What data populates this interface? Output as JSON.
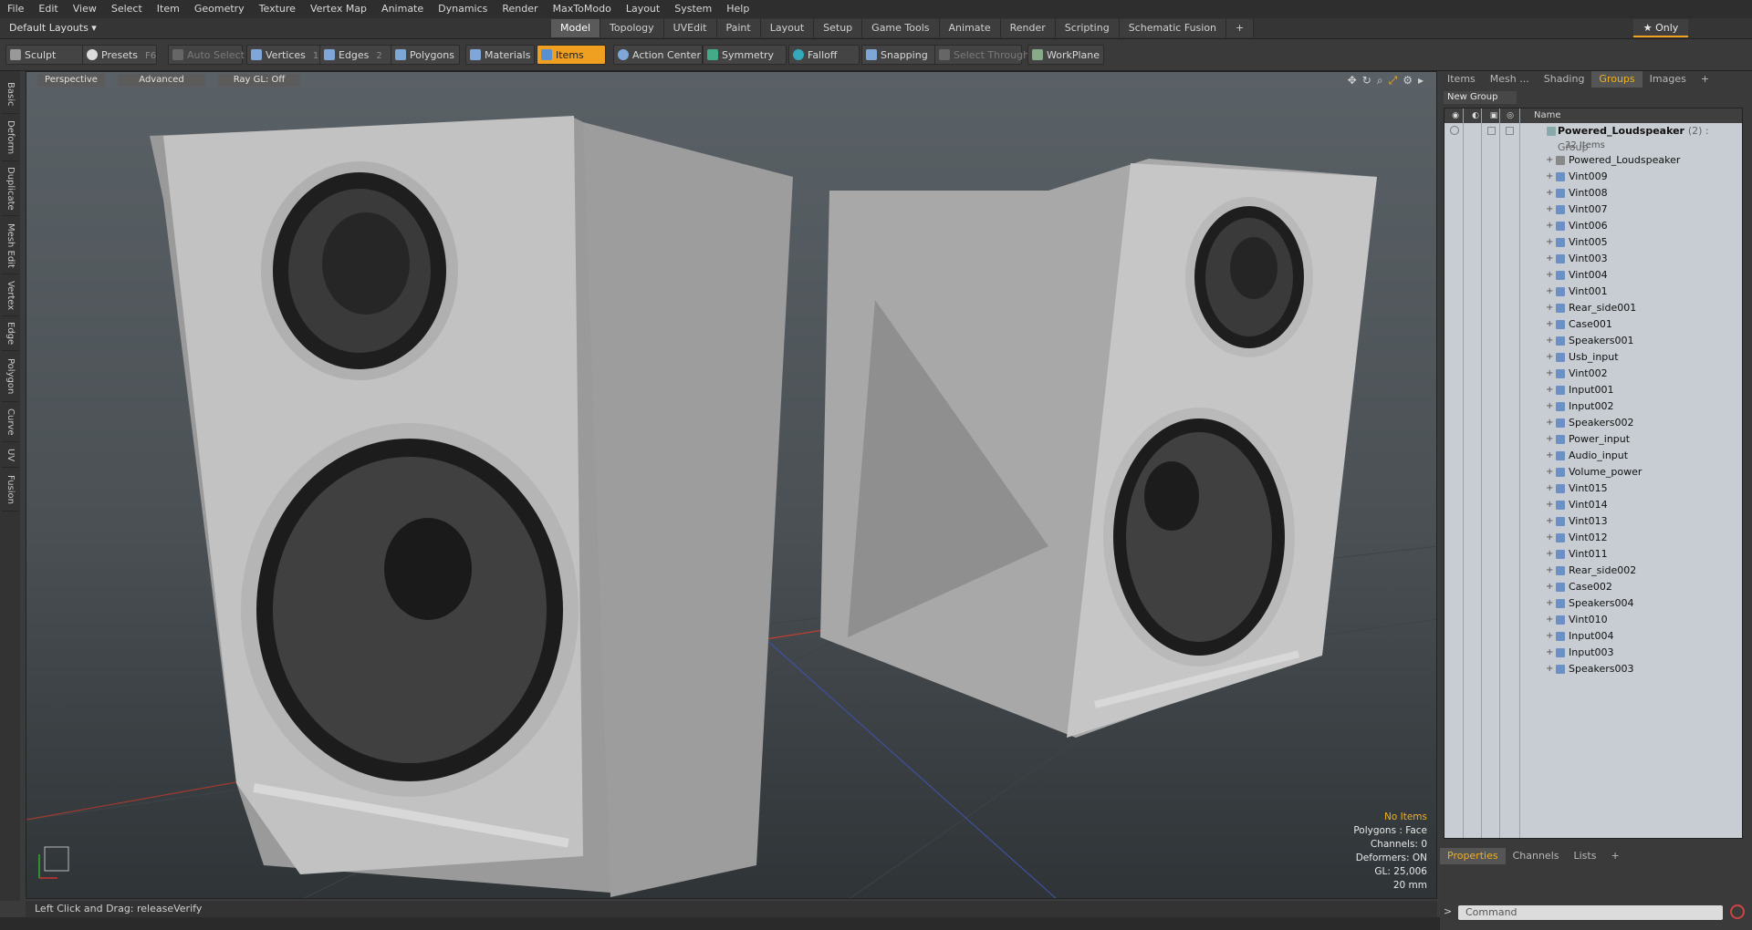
{
  "menubar": [
    "File",
    "Edit",
    "View",
    "Select",
    "Item",
    "Geometry",
    "Texture",
    "Vertex Map",
    "Animate",
    "Dynamics",
    "Render",
    "MaxToModo",
    "Layout",
    "System",
    "Help"
  ],
  "layout": {
    "selector": "Default Layouts ▾",
    "tabs": [
      "Model",
      "Topology",
      "UVEdit",
      "Paint",
      "Layout",
      "Setup",
      "Game Tools",
      "Animate",
      "Render",
      "Scripting",
      "Schematic Fusion",
      "+"
    ],
    "active_tab": "Model",
    "only_label": "★ Only"
  },
  "toolbar": {
    "sculpt": "Sculpt",
    "presets": "Presets",
    "presets_key": "F6",
    "auto_select": "Auto Select",
    "vertices": "Vertices",
    "vertices_key": "1",
    "edges": "Edges",
    "edges_key": "2",
    "polygons": "Polygons",
    "materials": "Materials",
    "items": "Items",
    "action_center": "Action Center",
    "symmetry": "Symmetry",
    "falloff": "Falloff",
    "snapping": "Snapping",
    "select_through": "Select Through",
    "workplane": "WorkPlane"
  },
  "lefttabs": [
    "Basic",
    "Deform",
    "Duplicate",
    "Mesh Edit",
    "Vertex",
    "Edge",
    "Polygon",
    "Curve",
    "UV",
    "Fusion"
  ],
  "viewport": {
    "view": "Perspective",
    "shading": "Advanced",
    "raygl": "Ray GL: Off",
    "stats": {
      "items": "No Items",
      "polygons": "Polygons : Face",
      "channels": "Channels: 0",
      "deformers": "Deformers: ON",
      "gl": "GL: 25,006",
      "size": "20 mm"
    }
  },
  "status": {
    "text": "Left Click and Drag:   releaseVerify"
  },
  "panel": {
    "tabs": [
      "Items",
      "Mesh ...",
      "Shading",
      "Groups",
      "Images",
      "+"
    ],
    "active_tab": "Groups",
    "new_group": "New Group",
    "name_header": "Name",
    "group": {
      "name": "Powered_Loudspeaker",
      "suffix": "(2) : Group",
      "count": "32 Items"
    },
    "items": [
      "Powered_Loudspeaker",
      "Vint009",
      "Vint008",
      "Vint007",
      "Vint006",
      "Vint005",
      "Vint003",
      "Vint004",
      "Vint001",
      "Rear_side001",
      "Case001",
      "Speakers001",
      "Usb_input",
      "Vint002",
      "Input001",
      "Input002",
      "Speakers002",
      "Power_input",
      "Audio_input",
      "Volume_power",
      "Vint015",
      "Vint014",
      "Vint013",
      "Vint012",
      "Vint011",
      "Rear_side002",
      "Case002",
      "Speakers004",
      "Vint010",
      "Input004",
      "Input003",
      "Speakers003"
    ],
    "lower_tabs": [
      "Properties",
      "Channels",
      "Lists",
      "+"
    ],
    "lower_active": "Properties",
    "command_placeholder": "Command"
  }
}
